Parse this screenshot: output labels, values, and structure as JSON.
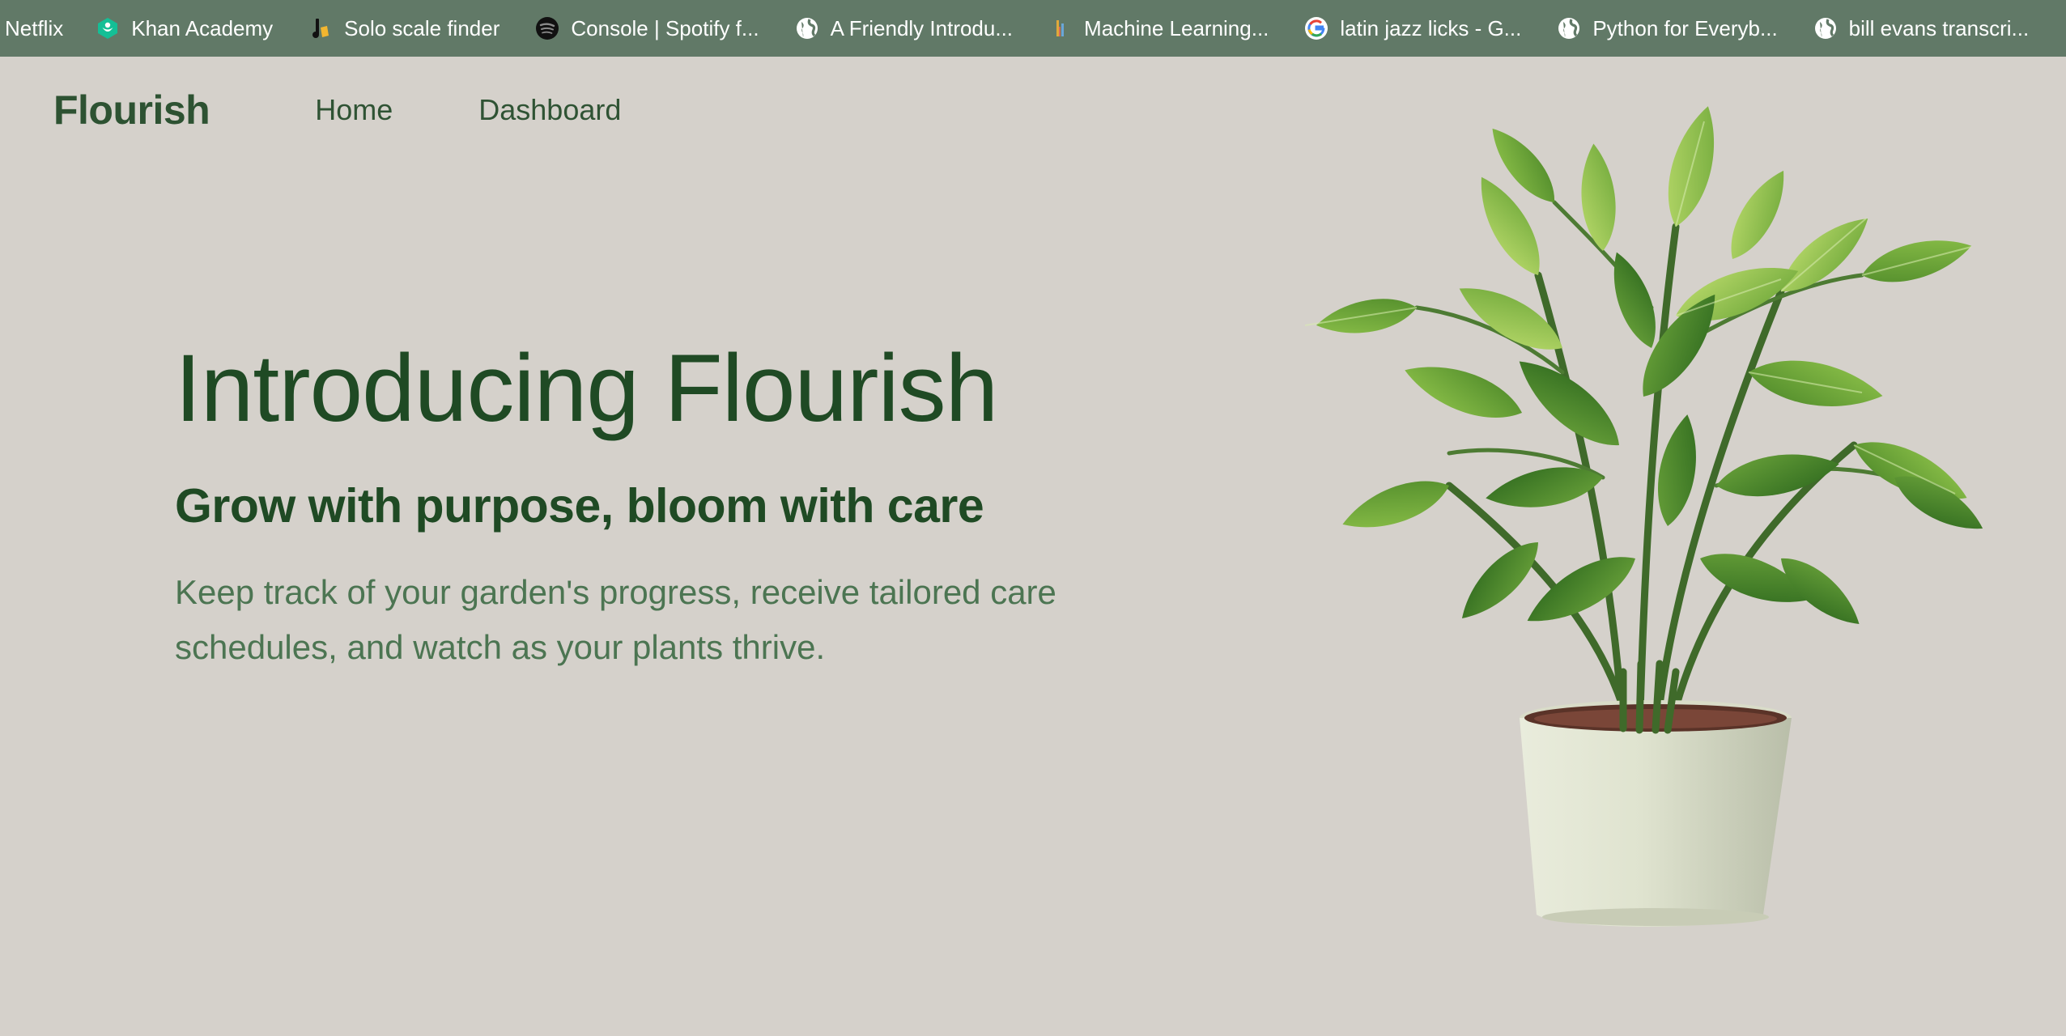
{
  "bookmarks": [
    {
      "label": "Netflix",
      "icon": "none"
    },
    {
      "label": "Khan Academy",
      "icon": "khan-academy-icon"
    },
    {
      "label": "Solo scale finder",
      "icon": "solo-scale-icon"
    },
    {
      "label": "Console | Spotify f...",
      "icon": "spotify-icon"
    },
    {
      "label": "A Friendly Introdu...",
      "icon": "globe-icon"
    },
    {
      "label": "Machine Learning...",
      "icon": "ml-bars-icon"
    },
    {
      "label": "latin jazz licks - G...",
      "icon": "google-icon"
    },
    {
      "label": "Python for Everyb...",
      "icon": "globe-icon"
    },
    {
      "label": "bill evans transcri...",
      "icon": "globe-icon"
    }
  ],
  "header": {
    "brand": "Flourish",
    "nav": [
      {
        "label": "Home"
      },
      {
        "label": "Dashboard"
      }
    ]
  },
  "hero": {
    "title": "Introducing Flourish",
    "subtitle": "Grow with purpose, bloom with care",
    "body": "Keep track of your garden's progress, receive tailored care schedules, and watch as your plants thrive."
  },
  "colors": {
    "bookmark_bar": "#617967",
    "page_background": "#d5d1cb",
    "brand_green": "#2d5232",
    "headline_green": "#1f4a24",
    "body_green": "#4c7552"
  }
}
